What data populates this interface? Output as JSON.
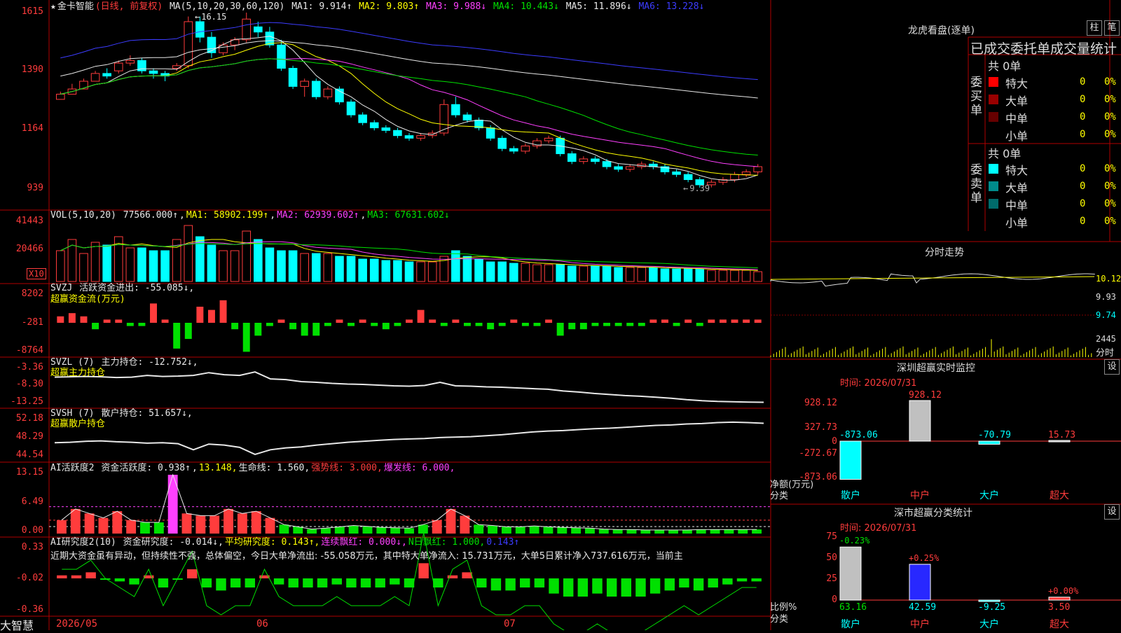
{
  "stock": {
    "name": "金卡智能",
    "mode": "(日线, 前复权)"
  },
  "main_chart": {
    "ma_header": "MA(5,10,20,30,60,120)",
    "ma": [
      {
        "label": "MA1: 9.914↑",
        "color": "#e8e8e8"
      },
      {
        "label": "MA2: 9.803↑",
        "color": "#ffff00"
      },
      {
        "label": "MA3: 9.988↓",
        "color": "#ff40ff"
      },
      {
        "label": "MA4: 10.443↓",
        "color": "#00e000"
      },
      {
        "label": "MA5: 11.896↓",
        "color": "#e8e8e8"
      },
      {
        "label": "MA6: 13.228↓",
        "color": "#3c3cff"
      }
    ],
    "y_ticks": [
      "1615",
      "1390",
      "1164",
      "939"
    ],
    "high_label": "16.15",
    "low_label": "9.39"
  },
  "vol_panel": {
    "header": "VOL(5,10,20)",
    "value": "77566.000↑",
    "ma1": "MA1: 58902.199↑",
    "ma2": "MA2: 62939.602↑",
    "ma3": "MA3: 67631.602↓",
    "y_ticks": [
      "41443",
      "20466"
    ],
    "unit": "X10"
  },
  "svzj_panel": {
    "header": "SVZJ",
    "title": "活跃资金进出: -55.085↓,",
    "sub": "超赢资金流(万元)",
    "y_ticks": [
      "8202",
      "-281",
      "-8764"
    ]
  },
  "svzl_panel": {
    "header": "SVZL (7)",
    "title": "主力持仓: -12.752↓,",
    "sub": "超赢主力持仓",
    "y_ticks": [
      "-3.36",
      "-8.30",
      "-13.25"
    ]
  },
  "svsh_panel": {
    "header": "SVSH (7)",
    "title": "散户持仓: 51.657↓,",
    "sub": "超赢散户持仓",
    "y_ticks": [
      "52.18",
      "48.29",
      "44.54"
    ]
  },
  "ai_active_panel": {
    "header": "AI活跃度2",
    "title": "资金活跃度: 0.938↑",
    "v2": "13.148,",
    "life": "生命线: 1.560,",
    "strong": "强势线: 3.000,",
    "burst": "爆发线: 6.000,",
    "y_ticks": [
      "13.15",
      "6.49",
      "0.00"
    ]
  },
  "ai_research_panel": {
    "header": "AI研究度2(10)",
    "title": "资金研究度: -0.014↓,",
    "avg": "平均研究度: 0.143↑,",
    "red": "连续飘红: 0.000↓,",
    "nred": "N日飘红: 1.000,",
    "nval": "0.143↑",
    "commentary": "近期大资金虽有异动，但持续性不强，总体偏空，今日大单净流出: -55.058万元，其中特大单净流入: 15.731万元，大单5日累计净入737.616万元，当前主",
    "y_ticks": [
      "0.33",
      "-0.02",
      "-0.36"
    ]
  },
  "x_axis": {
    "labels": [
      "2026/05",
      "06",
      "07"
    ],
    "brand": "大智慧"
  },
  "right_panel": {
    "dragon_title": "龙虎看盘(逐单)",
    "tab_bar": "柱",
    "tab_note": "笔",
    "header_row": "已成交委托单成交量统计",
    "buy": {
      "side_label": "委买单",
      "count": "共 0单",
      "rows": [
        {
          "name": "特大",
          "vol": "0",
          "pct": "0%",
          "color": "#ff0000"
        },
        {
          "name": "大单",
          "vol": "0",
          "pct": "0%",
          "color": "#990000"
        },
        {
          "name": "中单",
          "vol": "0",
          "pct": "0%",
          "color": "#660000"
        },
        {
          "name": "小单",
          "vol": "0",
          "pct": "0%",
          "color": "#000000"
        }
      ]
    },
    "sell": {
      "side_label": "委卖单",
      "count": "共 0单",
      "rows": [
        {
          "name": "特大",
          "vol": "0",
          "pct": "0%",
          "color": "#00ffff"
        },
        {
          "name": "大单",
          "vol": "0",
          "pct": "0%",
          "color": "#008b8b"
        },
        {
          "name": "中单",
          "vol": "0",
          "pct": "0%",
          "color": "#006b6b"
        },
        {
          "name": "小单",
          "vol": "0",
          "pct": "0%",
          "color": "#000000"
        }
      ]
    },
    "intraday": {
      "title": "分时走势",
      "prices": [
        "10.12",
        "9.93",
        "9.74"
      ],
      "vol": "2445",
      "vol_label": "分时"
    },
    "sz_monitor": {
      "title": "深圳超赢实时监控",
      "settings": "设",
      "time": "时间: 2026/07/31",
      "y_ticks": [
        "928.12",
        "327.73",
        "0",
        "-272.67",
        "-873.06"
      ],
      "ylabel": "净额(万元)",
      "xlabel": "分类",
      "categories": [
        "散户",
        "中户",
        "大户",
        "超大"
      ],
      "values": [
        -873.06,
        928.12,
        -70.79,
        15.73
      ],
      "value_labels": [
        "-873.06",
        "928.12",
        "-70.79",
        "15.73"
      ]
    },
    "sz_category": {
      "title": "深市超赢分类统计",
      "settings": "设",
      "time": "时间: 2026/07/31",
      "y_ticks": [
        "75",
        "50",
        "25",
        "0"
      ],
      "ylabel": "比例%",
      "xlabel": "分类",
      "categories": [
        "散户",
        "中户",
        "大户",
        "超大"
      ],
      "values": [
        63.16,
        42.59,
        -9.25,
        3.5
      ],
      "value_labels": [
        "63.16",
        "42.59",
        "-9.25",
        "3.50"
      ],
      "delta_labels": [
        "-0.23%",
        "+0.25%",
        "",
        "+0.00%"
      ]
    }
  },
  "chart_data": [
    {
      "type": "candlestick",
      "title": "金卡智能 (日线, 前复权)",
      "ylim": [
        9.39,
        16.15
      ],
      "y_tick_labels": [
        "1615",
        "1390",
        "1164",
        "939"
      ],
      "x_labels": [
        "2026/05",
        "06",
        "07"
      ],
      "candles": [
        [
          12.8,
          13.1,
          12.9,
          13.0
        ],
        [
          13.0,
          13.4,
          13.1,
          13.2
        ],
        [
          13.2,
          13.6,
          13.3,
          13.5
        ],
        [
          13.5,
          13.9,
          13.6,
          13.8
        ],
        [
          13.8,
          14.0,
          13.6,
          13.7
        ],
        [
          13.9,
          14.3,
          13.8,
          14.2
        ],
        [
          14.2,
          14.5,
          14.1,
          14.3
        ],
        [
          14.3,
          14.4,
          13.8,
          13.9
        ],
        [
          13.9,
          14.0,
          13.6,
          13.8
        ],
        [
          13.8,
          13.9,
          13.5,
          13.7
        ],
        [
          14.0,
          14.2,
          13.9,
          14.1
        ],
        [
          14.1,
          16.0,
          14.0,
          15.8
        ],
        [
          15.8,
          16.0,
          15.0,
          15.2
        ],
        [
          15.2,
          15.4,
          14.4,
          14.6
        ],
        [
          14.6,
          15.0,
          14.5,
          14.9
        ],
        [
          14.9,
          15.2,
          14.7,
          15.1
        ],
        [
          15.1,
          16.15,
          15.0,
          15.9
        ],
        [
          15.6,
          15.8,
          15.2,
          15.4
        ],
        [
          15.4,
          15.6,
          14.8,
          14.9
        ],
        [
          14.9,
          15.1,
          13.9,
          14.0
        ],
        [
          14.0,
          14.1,
          13.2,
          13.3
        ],
        [
          13.3,
          13.6,
          12.9,
          13.5
        ],
        [
          13.5,
          13.6,
          12.8,
          12.9
        ],
        [
          12.9,
          13.3,
          12.8,
          13.2
        ],
        [
          13.2,
          13.3,
          12.6,
          12.7
        ],
        [
          12.7,
          12.8,
          12.1,
          12.2
        ],
        [
          12.2,
          12.3,
          11.8,
          11.9
        ],
        [
          11.9,
          12.0,
          11.6,
          11.7
        ],
        [
          11.7,
          11.8,
          11.5,
          11.6
        ],
        [
          11.6,
          11.7,
          11.3,
          11.4
        ],
        [
          11.4,
          11.5,
          11.2,
          11.3
        ],
        [
          11.3,
          11.5,
          11.2,
          11.4
        ],
        [
          11.4,
          11.6,
          11.3,
          11.5
        ],
        [
          11.5,
          12.8,
          11.4,
          12.6
        ],
        [
          12.6,
          12.9,
          12.1,
          12.2
        ],
        [
          12.2,
          12.3,
          11.9,
          12.0
        ],
        [
          12.0,
          12.1,
          11.6,
          11.7
        ],
        [
          11.7,
          11.8,
          11.2,
          11.3
        ],
        [
          11.3,
          11.4,
          10.8,
          10.9
        ],
        [
          10.9,
          11.0,
          10.7,
          10.8
        ],
        [
          10.8,
          11.1,
          10.7,
          11.0
        ],
        [
          11.0,
          11.3,
          10.9,
          11.2
        ],
        [
          11.2,
          11.4,
          11.1,
          11.3
        ],
        [
          11.3,
          11.4,
          10.6,
          10.7
        ],
        [
          10.7,
          10.8,
          10.3,
          10.4
        ],
        [
          10.4,
          10.6,
          10.3,
          10.5
        ],
        [
          10.5,
          10.6,
          10.3,
          10.4
        ],
        [
          10.4,
          10.5,
          10.1,
          10.2
        ],
        [
          10.2,
          10.3,
          10.0,
          10.1
        ],
        [
          10.1,
          10.3,
          10.0,
          10.2
        ],
        [
          10.2,
          10.4,
          10.1,
          10.3
        ],
        [
          10.3,
          10.4,
          10.1,
          10.2
        ],
        [
          10.2,
          10.3,
          9.9,
          10.0
        ],
        [
          10.0,
          10.1,
          9.8,
          9.9
        ],
        [
          9.9,
          10.0,
          9.6,
          9.7
        ],
        [
          9.7,
          9.8,
          9.39,
          9.5
        ],
        [
          9.5,
          9.7,
          9.4,
          9.6
        ],
        [
          9.6,
          9.8,
          9.5,
          9.7
        ],
        [
          9.7,
          10.0,
          9.6,
          9.9
        ],
        [
          9.9,
          10.1,
          9.8,
          10.0
        ],
        [
          10.0,
          10.3,
          9.9,
          10.2
        ]
      ]
    },
    {
      "type": "bar",
      "title": "VOL(5,10,20)",
      "values": [
        22,
        30,
        20,
        28,
        26,
        32,
        24,
        24,
        22,
        22,
        30,
        40,
        32,
        26,
        22,
        22,
        36,
        30,
        24,
        22,
        22,
        20,
        20,
        20,
        18,
        18,
        16,
        16,
        15,
        15,
        14,
        14,
        14,
        18,
        22,
        18,
        16,
        14,
        14,
        13,
        13,
        12,
        12,
        12,
        11,
        11,
        11,
        11,
        10,
        10,
        10,
        10,
        9,
        9,
        9,
        9,
        8,
        8,
        8,
        8,
        7
      ]
    },
    {
      "type": "bar",
      "title": "活跃资金进出",
      "values": [
        2,
        3,
        2,
        -2,
        1,
        1,
        -1,
        -1,
        6,
        1,
        -8,
        -5,
        5,
        4,
        7,
        -2,
        -9,
        -4,
        -1,
        1,
        -2,
        -4,
        -4,
        -1,
        1,
        -1,
        1,
        -1,
        -2,
        -1,
        1,
        4,
        1,
        -1,
        1,
        -1,
        -1,
        -2,
        -1,
        1,
        -1,
        -1,
        1,
        -4,
        -2,
        -2,
        -1,
        -1,
        -1,
        -1,
        -1,
        1,
        1,
        -1,
        1,
        -1,
        1,
        1,
        1,
        1,
        1
      ]
    },
    {
      "type": "line",
      "title": "主力持仓",
      "values": [
        -5.5,
        -5.4,
        -5.3,
        -5.4,
        -5.6,
        -5.5,
        -5.0,
        -5.3,
        -5.2,
        -5.0,
        -4.2,
        -4.8,
        -5.0,
        -4.0,
        -6.0,
        -6.2,
        -6.8,
        -7.0,
        -7.3,
        -7.5,
        -7.6,
        -7.8,
        -8.0,
        -8.1,
        -7.9,
        -7.0,
        -8.0,
        -8.1,
        -8.3,
        -8.4,
        -8.6,
        -8.8,
        -9.0,
        -9.5,
        -9.8,
        -10.2,
        -10.5,
        -10.8,
        -11.0,
        -11.3,
        -11.6,
        -12.0,
        -12.3,
        -12.5,
        -12.6,
        -12.7,
        -12.75
      ]
    },
    {
      "type": "line",
      "title": "散户持仓",
      "values": [
        47.5,
        47.6,
        47.8,
        47.9,
        47.7,
        47.6,
        47.4,
        47.5,
        47.3,
        46.0,
        47.2,
        47.0,
        46.5,
        45.0,
        46.0,
        46.4,
        46.6,
        47.0,
        47.3,
        47.6,
        47.8,
        48.0,
        48.2,
        48.3,
        48.4,
        48.6,
        48.7,
        48.8,
        49.0,
        49.2,
        49.5,
        49.8,
        50.0,
        50.1,
        50.3,
        50.5,
        50.6,
        50.8,
        51.0,
        51.2,
        51.3,
        51.5,
        51.6,
        51.8,
        51.9,
        51.8,
        51.66
      ]
    },
    {
      "type": "bar",
      "title": "资金活跃度",
      "values": [
        3.0,
        5.5,
        4.5,
        3.5,
        5.0,
        3.0,
        2.5,
        2.5,
        13.15,
        4.5,
        4.0,
        4.0,
        5.5,
        4.5,
        5.0,
        3.5,
        2.0,
        1.5,
        1.0,
        1.2,
        1.5,
        1.8,
        1.6,
        1.4,
        1.3,
        1.2,
        2.0,
        3.0,
        5.5,
        4.0,
        2.0,
        1.8,
        1.5,
        1.5,
        1.7,
        1.5,
        1.4,
        1.3,
        1.2,
        1.0,
        0.9,
        0.9,
        0.8,
        0.8,
        0.8,
        0.8,
        0.9,
        0.9,
        0.9,
        0.9,
        0.93
      ]
    },
    {
      "type": "bar",
      "title": "资金研究度",
      "values": [
        0.01,
        0.01,
        0.02,
        0.0,
        -0.01,
        -0.02,
        0.01,
        -0.03,
        0.0,
        0.03,
        -0.03,
        -0.04,
        -0.03,
        -0.03,
        0.01,
        -0.02,
        -0.03,
        -0.03,
        -0.03,
        -0.02,
        -0.03,
        -0.03,
        -0.03,
        -0.02,
        -0.03,
        0.05,
        -0.03,
        0.01,
        0.02,
        -0.03,
        -0.04,
        -0.04,
        -0.03,
        -0.03,
        -0.05,
        -0.06,
        -0.06,
        -0.05,
        -0.06,
        -0.06,
        -0.06,
        -0.05,
        -0.04,
        -0.03,
        -0.04,
        -0.03,
        -0.02,
        -0.01,
        -0.01
      ]
    }
  ]
}
